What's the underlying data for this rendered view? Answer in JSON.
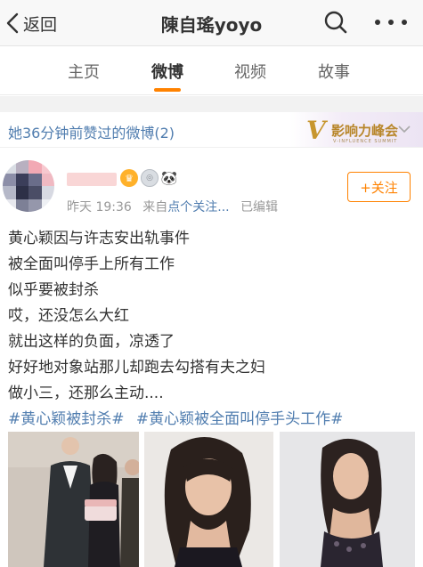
{
  "header": {
    "back_label": "返回",
    "title": "陳自瑤yoyo"
  },
  "tabs": [
    {
      "label": "主页",
      "active": false
    },
    {
      "label": "微博",
      "active": true
    },
    {
      "label": "视频",
      "active": false
    },
    {
      "label": "故事",
      "active": false
    }
  ],
  "liked_bar": {
    "text": "她36分钟前赞过的微博(2)",
    "promo_title": "影响力峰会",
    "promo_sub": "V-INFLUENCE SUMMIT"
  },
  "post": {
    "time": "昨天 19:36",
    "source_prefix": "来自",
    "source": "点个关注...",
    "edited": "已编辑",
    "follow_label": "+关注",
    "lines": [
      "黄心颖因与许志安出轨事件",
      "被全面叫停手上所有工作",
      "似乎要被封杀",
      "哎，还没怎么大红",
      "就出这样的负面，凉透了",
      "好好地对象站那儿却跑去勾搭有夫之妇",
      "做小三，还那么主动...."
    ],
    "hashtags": [
      "#黄心颖被封杀#",
      "#黄心颖被全面叫停手头工作#"
    ]
  },
  "colors": {
    "accent": "#ff8200",
    "link": "#507daf",
    "text": "#333333",
    "muted": "#999999"
  },
  "icons": [
    "chevron-left-icon",
    "search-icon",
    "more-icon",
    "chevron-down-icon",
    "crown-icon",
    "medal-icon",
    "panda-icon"
  ]
}
